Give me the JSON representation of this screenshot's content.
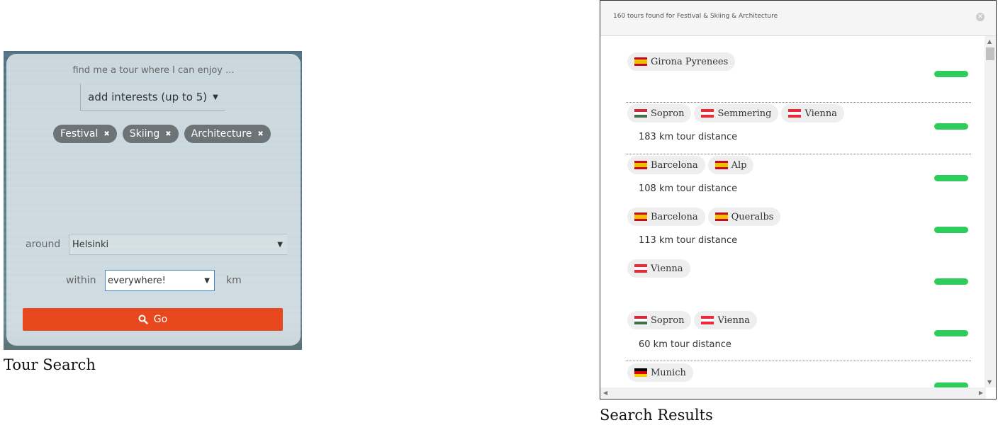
{
  "tour_search": {
    "prompt": "find me a tour where I can enjoy ...",
    "interest_select_label": "add interests (up to 5)",
    "selected_interests": [
      "Festival",
      "Skiing",
      "Architecture"
    ],
    "around_label": "around",
    "around_value": "Helsinki",
    "within_label": "within",
    "within_value": "everywhere!",
    "km_label": "km",
    "go_label": "Go",
    "caption": "Tour Search"
  },
  "search_results": {
    "header": "160 tours found for Festival & Skiing & Architecture",
    "caption": "Search Results",
    "results": [
      {
        "stops": [
          {
            "name": "Girona Pyrenees",
            "flag": "es"
          }
        ],
        "distance": ""
      },
      {
        "stops": [
          {
            "name": "Sopron",
            "flag": "hu"
          },
          {
            "name": "Semmering",
            "flag": "at"
          },
          {
            "name": "Vienna",
            "flag": "at"
          }
        ],
        "distance": "183 km tour distance"
      },
      {
        "stops": [
          {
            "name": "Barcelona",
            "flag": "es"
          },
          {
            "name": "Alp",
            "flag": "es"
          }
        ],
        "distance": "108 km tour distance"
      },
      {
        "stops": [
          {
            "name": "Barcelona",
            "flag": "es"
          },
          {
            "name": "Queralbs",
            "flag": "es"
          }
        ],
        "distance": "113 km tour distance"
      },
      {
        "stops": [
          {
            "name": "Vienna",
            "flag": "at"
          }
        ],
        "distance": ""
      },
      {
        "stops": [
          {
            "name": "Sopron",
            "flag": "hu"
          },
          {
            "name": "Vienna",
            "flag": "at"
          }
        ],
        "distance": "60 km tour distance"
      },
      {
        "stops": [
          {
            "name": "Munich",
            "flag": "de"
          }
        ],
        "distance": ""
      }
    ]
  },
  "colors": {
    "go_button": "#e8481e",
    "rating_bar": "#2ecc5a",
    "tag": "#6c7478"
  }
}
